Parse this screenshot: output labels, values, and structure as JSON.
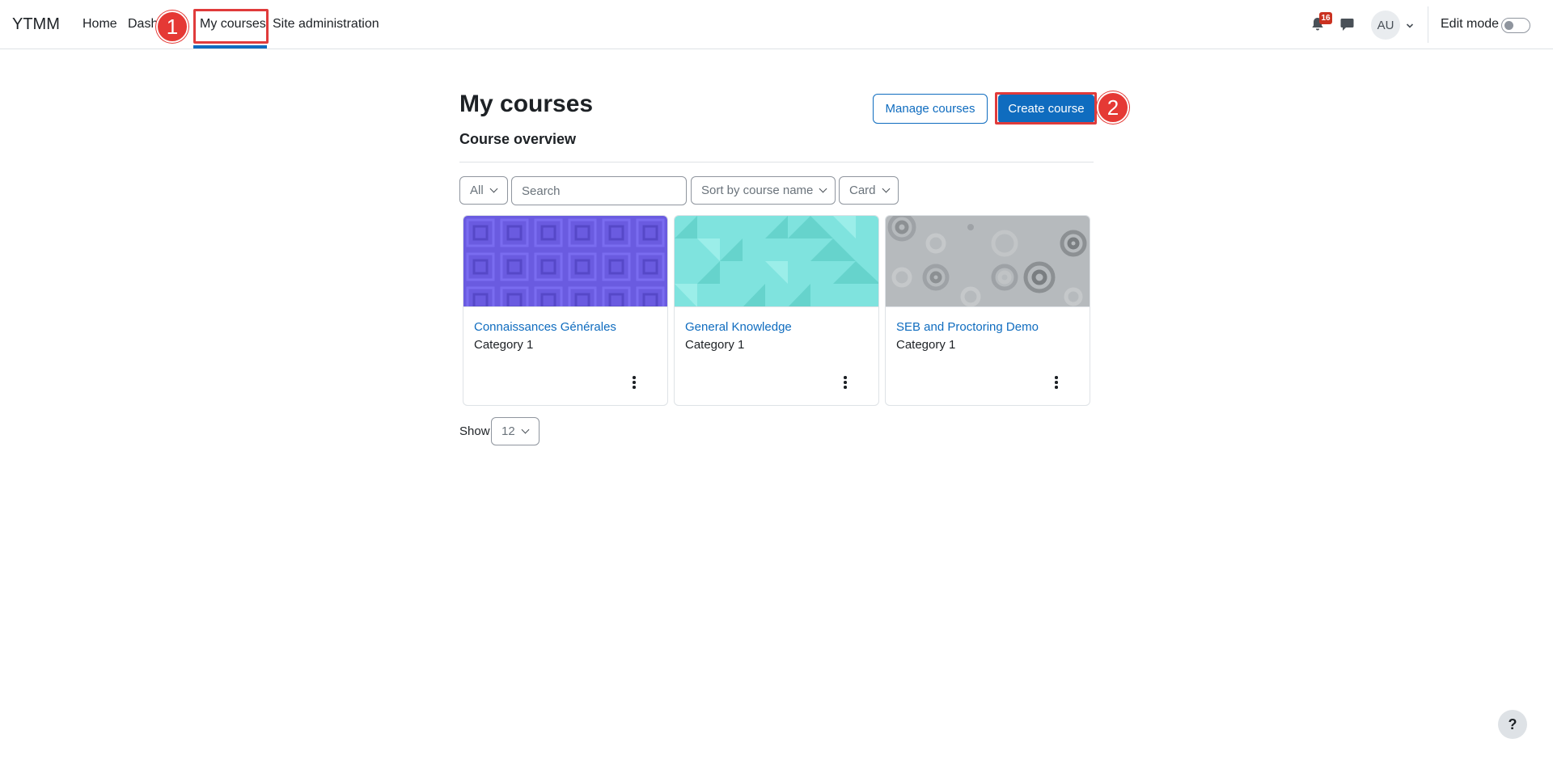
{
  "navbar": {
    "brand": "YTMM",
    "items": [
      {
        "label": "Home"
      },
      {
        "label": "Dashb"
      },
      {
        "label": "My courses"
      },
      {
        "label": "Site administration"
      }
    ],
    "notification_count": "16",
    "avatar_initials": "AU",
    "edit_mode_label": "Edit mode",
    "edit_mode_on": false,
    "icons": [
      "bell-icon",
      "chat-icon",
      "chevron-down-icon"
    ]
  },
  "annotations": [
    {
      "number": "1",
      "target": "My courses"
    },
    {
      "number": "2",
      "target": "Create course"
    }
  ],
  "main": {
    "title": "My courses",
    "section_title": "Course overview",
    "manage_courses_label": "Manage courses",
    "create_course_label": "Create course",
    "filters": {
      "grouping": "All",
      "search_placeholder": "Search",
      "sort": "Sort by course name",
      "view": "Card"
    },
    "courses": [
      {
        "name": "Connaissances Générales",
        "category": "Category 1",
        "image_color": "#6a5be0"
      },
      {
        "name": "General Knowledge",
        "category": "Category 1",
        "image_color": "#7fe3de"
      },
      {
        "name": "SEB and Proctoring Demo",
        "category": "Category 1",
        "image_color": "#b6babd"
      }
    ],
    "paging": {
      "label": "Show",
      "value": "12"
    }
  },
  "help_label": "?",
  "colors": {
    "primary": "#0f6cbf",
    "annotation": "#e53935",
    "badge": "#ca3120"
  }
}
